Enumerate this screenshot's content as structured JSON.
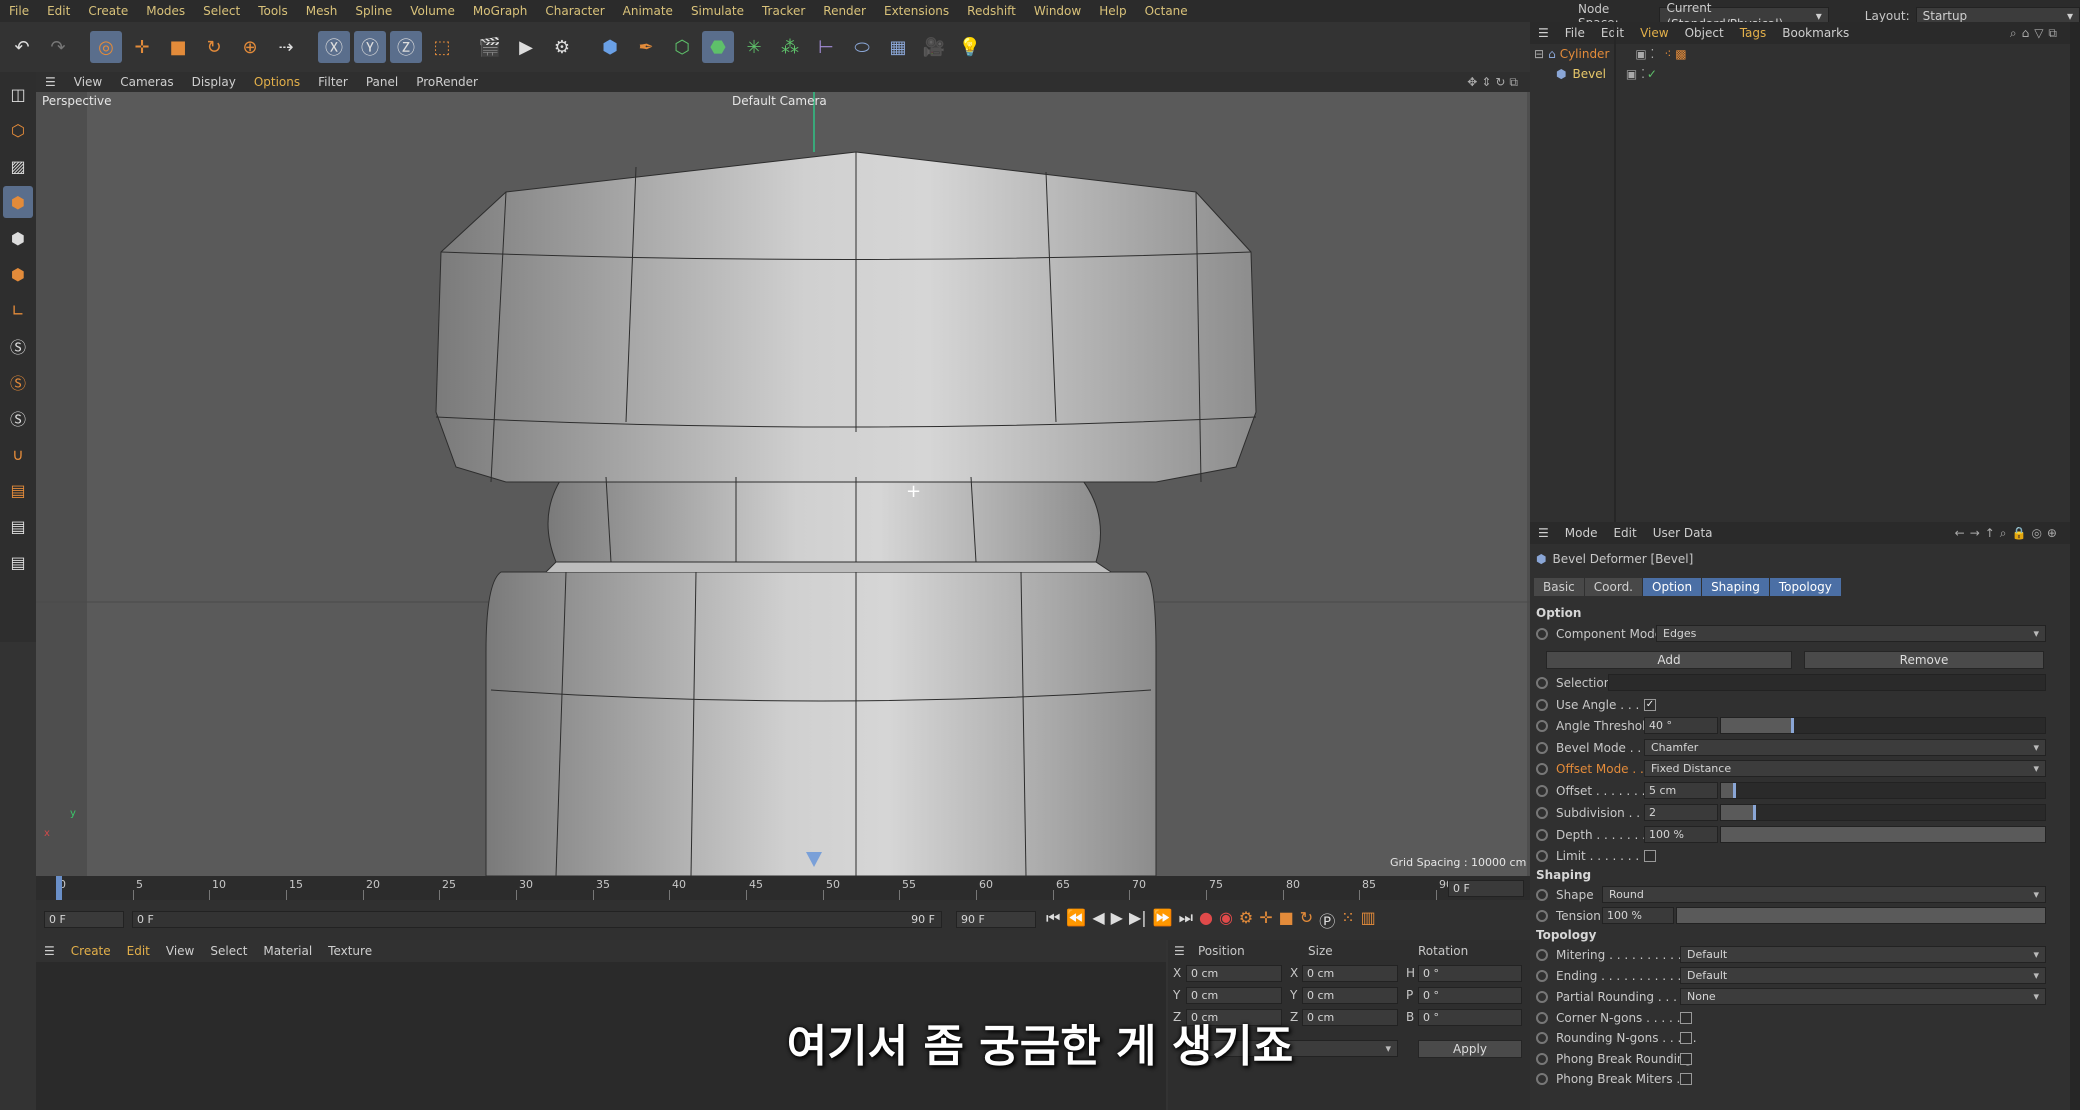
{
  "menubar": {
    "items": [
      "File",
      "Edit",
      "Create",
      "Modes",
      "Select",
      "Tools",
      "Mesh",
      "Spline",
      "Volume",
      "MoGraph",
      "Character",
      "Animate",
      "Simulate",
      "Tracker",
      "Render",
      "Extensions",
      "Redshift",
      "Window",
      "Help",
      "Octane"
    ],
    "node_space_label": "Node Space:",
    "node_space_value": "Current (Standard/Physical)",
    "layout_label": "Layout:",
    "layout_value": "Startup"
  },
  "viewport": {
    "menu": [
      "View",
      "Cameras",
      "Display",
      "Options",
      "Filter",
      "Panel",
      "ProRender"
    ],
    "label": "Perspective",
    "camera": "Default Camera",
    "grid_spacing": "Grid Spacing : 10000 cm",
    "axis_y": "y",
    "axis_x": "x"
  },
  "timeline": {
    "ticks": [
      "0",
      "5",
      "10",
      "15",
      "20",
      "25",
      "30",
      "35",
      "40",
      "45",
      "50",
      "55",
      "60",
      "65",
      "70",
      "75",
      "80",
      "85",
      "90"
    ],
    "current_frame": "0 F",
    "start": "0 F",
    "range_start": "0 F",
    "range_end": "90 F",
    "end": "90 F"
  },
  "material": {
    "menu": [
      "Create",
      "Edit",
      "View",
      "Select",
      "Material",
      "Texture"
    ]
  },
  "coords": {
    "headers": [
      "Position",
      "Size",
      "Rotation"
    ],
    "rows": [
      {
        "axis": "X",
        "pos": "0 cm",
        "saxis": "X",
        "size": "0 cm",
        "raxis": "H",
        "rot": "0 °"
      },
      {
        "axis": "Y",
        "pos": "0 cm",
        "saxis": "Y",
        "size": "0 cm",
        "raxis": "P",
        "rot": "0 °"
      },
      {
        "axis": "Z",
        "pos": "0 cm",
        "saxis": "Z",
        "size": "0 cm",
        "raxis": "B",
        "rot": "0 °"
      }
    ],
    "apply": "Apply"
  },
  "objects": {
    "menu": [
      "File",
      "Edit",
      "View",
      "Object",
      "Tags",
      "Bookmarks"
    ],
    "items": [
      {
        "name": "Cylinder",
        "color": "#e38b3a"
      },
      {
        "name": "Bevel",
        "color": "#e8c86a"
      }
    ]
  },
  "attributes": {
    "menu": [
      "Mode",
      "Edit",
      "User Data"
    ],
    "title": "Bevel Deformer [Bevel]",
    "tabs": [
      "Basic",
      "Coord.",
      "Option",
      "Shaping",
      "Topology"
    ],
    "option_section": "Option",
    "component_mode_label": "Component Mode",
    "component_mode_value": "Edges",
    "add": "Add",
    "remove": "Remove",
    "selection_label": "Selection",
    "use_angle_label": "Use Angle . . . .",
    "angle_threshold_label": "Angle Threshold",
    "angle_threshold_value": "40 °",
    "bevel_mode_label": "Bevel Mode . . .",
    "bevel_mode_value": "Chamfer",
    "offset_mode_label": "Offset Mode . . .",
    "offset_mode_value": "Fixed Distance",
    "offset_label": "Offset . . . . . . .",
    "offset_value": "5 cm",
    "subdivision_label": "Subdivision . . . .",
    "subdivision_value": "2",
    "depth_label": "Depth . . . . . . .",
    "depth_value": "100 %",
    "limit_label": "Limit . . . . . . . .",
    "shaping_section": "Shaping",
    "shape_label": "Shape",
    "shape_value": "Round",
    "tension_label": "Tension",
    "tension_value": "100 %",
    "topology_section": "Topology",
    "mitering_label": "Mitering . . . . . . . . . . . .",
    "mitering_value": "Default",
    "ending_label": "Ending . . . . . . . . . . . . .",
    "ending_value": "Default",
    "partial_rounding_label": "Partial Rounding . . . . .",
    "partial_rounding_value": "None",
    "corner_ngons_label": "Corner N-gons . . . . . .",
    "rounding_ngons_label": "Rounding N-gons . . . . .",
    "phong_break_rounding_label": "Phong Break Rounding",
    "phong_break_miters_label": "Phong Break Miters . ."
  },
  "subtitle": "여기서 좀 궁금한 게 생기죠"
}
